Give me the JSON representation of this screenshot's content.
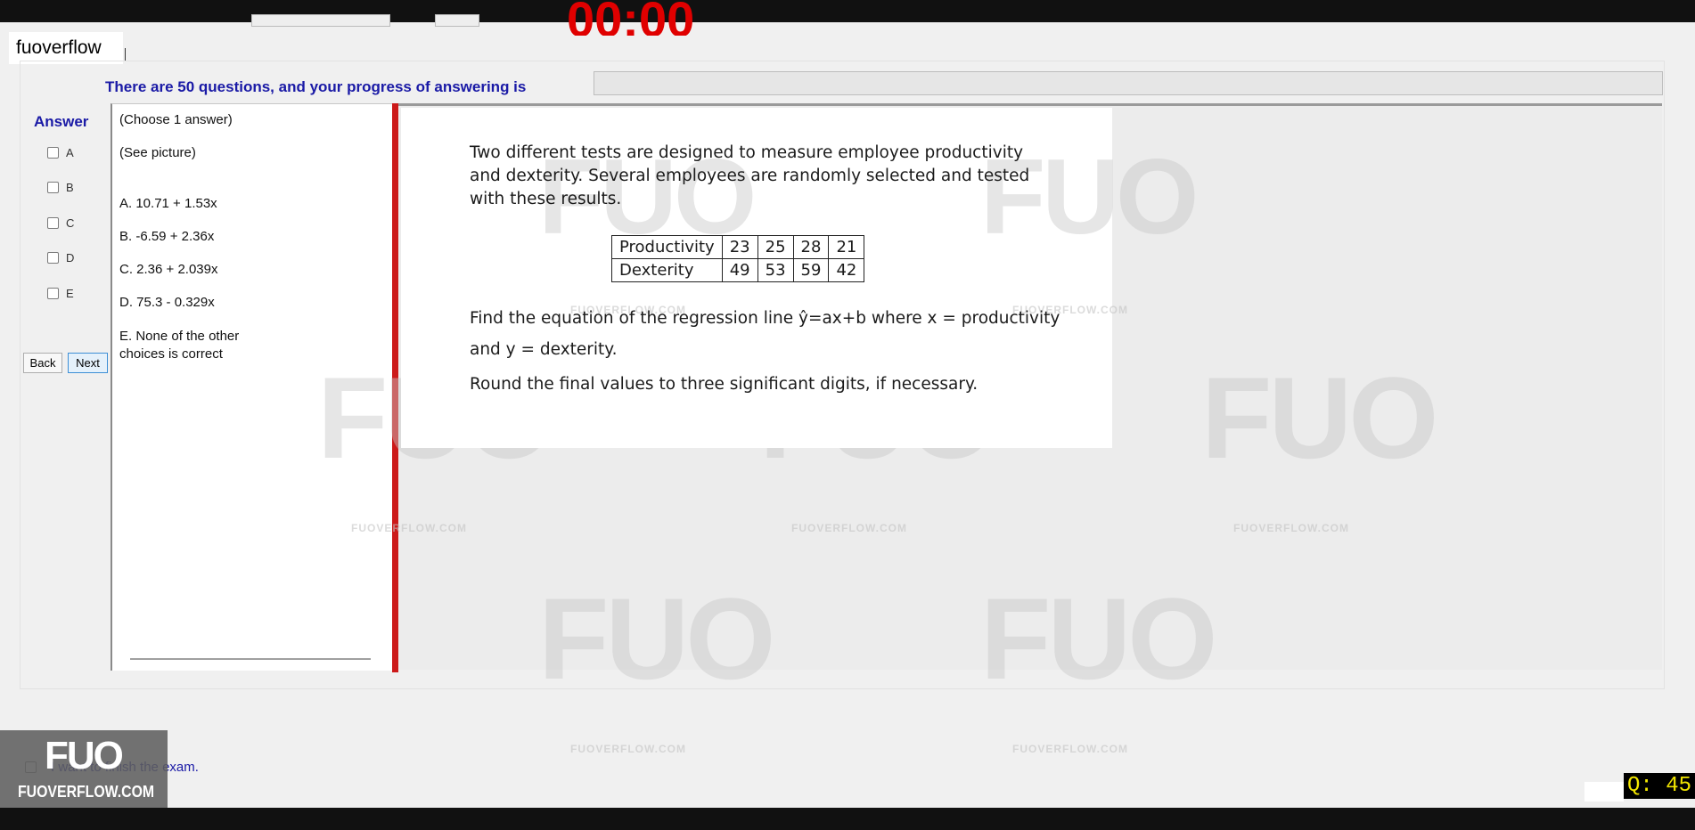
{
  "app": {
    "brand_tab": "fuoverflow"
  },
  "timer": {
    "display": "00:00",
    "color": "#e00000"
  },
  "progress": {
    "text": "There are 50 questions, and your progress of answering is",
    "fraction": 0.0
  },
  "answer": {
    "title": "Answer",
    "choices": [
      {
        "label": "A",
        "checked": false
      },
      {
        "label": "B",
        "checked": false
      },
      {
        "label": "C",
        "checked": false
      },
      {
        "label": "D",
        "checked": false
      },
      {
        "label": "E",
        "checked": false
      }
    ]
  },
  "nav": {
    "back_label": "Back",
    "next_label": "Next"
  },
  "options_panel": {
    "instruction": "(Choose 1 answer)",
    "see_picture": "(See picture)",
    "options": [
      "A.  10.71 + 1.53x",
      "B.  -6.59 + 2.36x",
      "C.  2.36 + 2.039x",
      "D.  75.3 - 0.329x"
    ],
    "option_e_line1": "E.  None of the other",
    "option_e_line2": "choices is correct"
  },
  "question": {
    "intro_line1": "Two different tests are designed to measure employee productivity",
    "intro_line2": "and dexterity. Several employees are randomly selected and tested",
    "intro_line3": "with these results.",
    "table": {
      "row1_header": "Productivity",
      "row1_values": [
        "23",
        "25",
        "28",
        "21"
      ],
      "row2_header": "Dexterity",
      "row2_values": [
        "49",
        "53",
        "59",
        "42"
      ]
    },
    "prompt_line1": "Find the equation of the regression line ŷ=ax+b where x = productivity",
    "prompt_line2": "and  y = dexterity.",
    "prompt_line3": "Round the final values to three significant digits, if necessary."
  },
  "watermark": {
    "big": "FUO",
    "small": "FUOVERFLOW.COM"
  },
  "finish": {
    "label": "I want to finish the exam.",
    "checked": false
  },
  "logo": {
    "big": "FUO",
    "small": "FUOVERFLOW.COM"
  },
  "counter": {
    "text": "Q: 45",
    "color": "#f2e600"
  }
}
